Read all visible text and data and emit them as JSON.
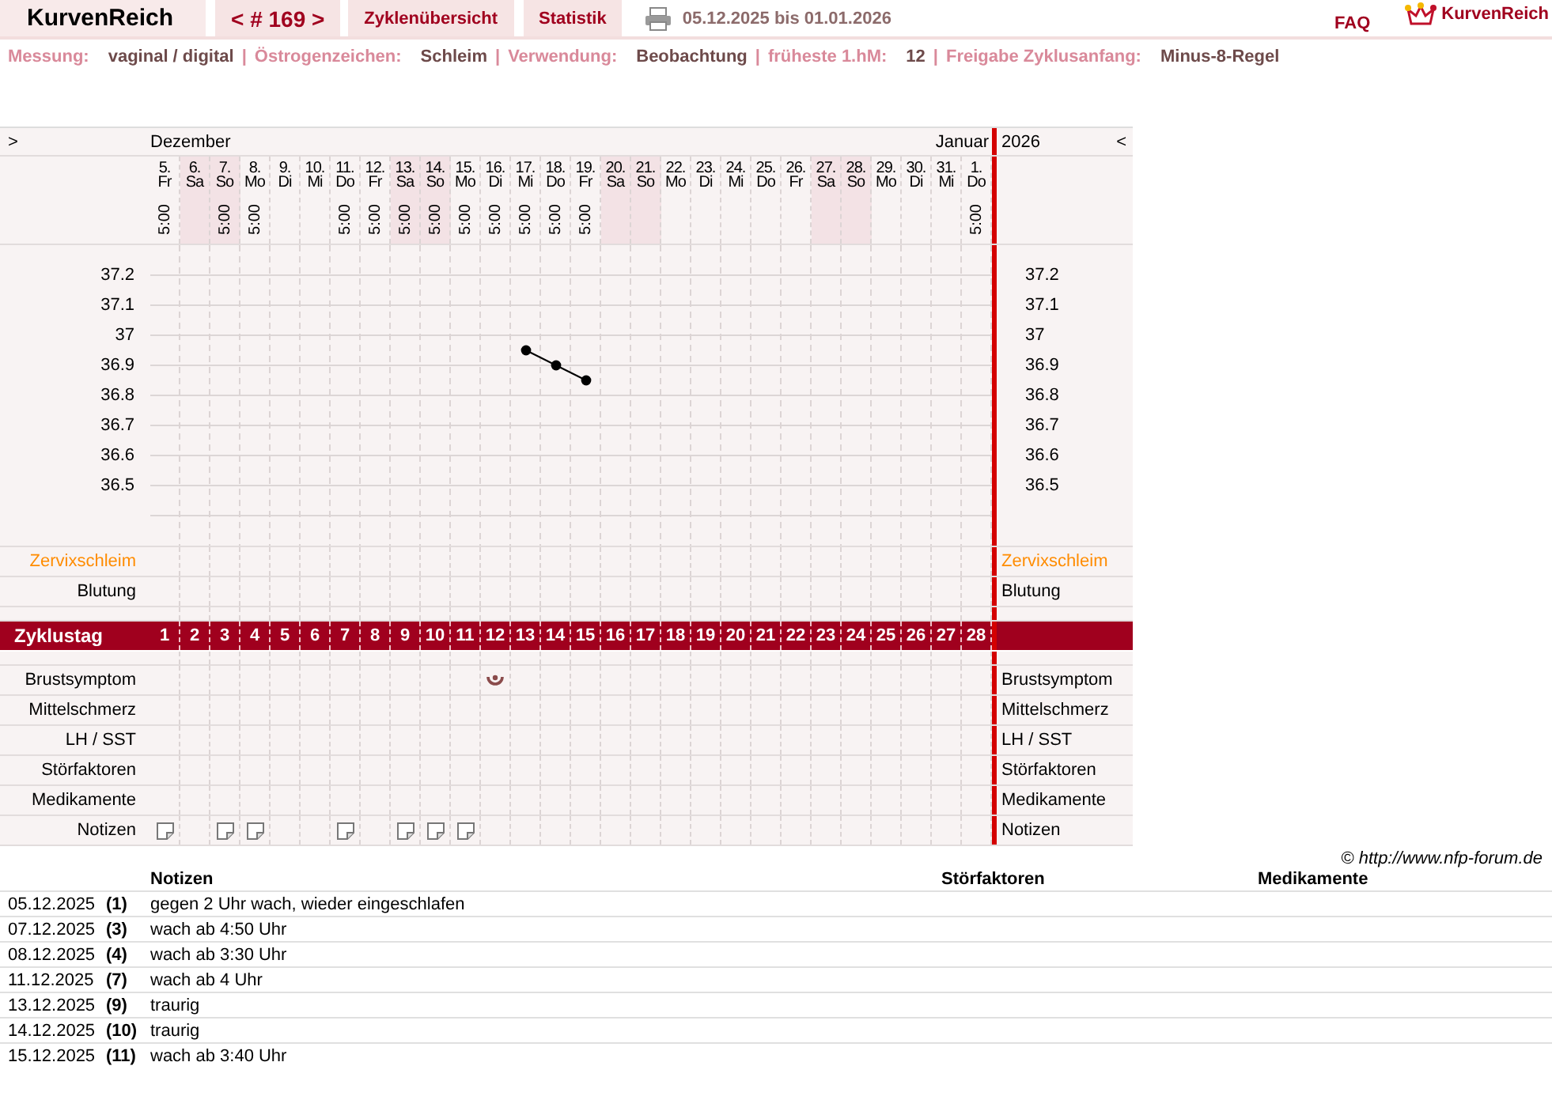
{
  "header": {
    "brand": "KurvenReich",
    "tabs": [
      {
        "label": "< # 169 >"
      },
      {
        "label": "Zyklenübersicht"
      },
      {
        "label": "Statistik"
      }
    ],
    "date_range": "05.12.2025 bis 01.01.2026",
    "faq": "FAQ",
    "logo_text": "KurvenReich"
  },
  "settings": {
    "separator": "|",
    "items": [
      {
        "label": "Messung:",
        "value": "vaginal / digital"
      },
      {
        "label": "Östrogenzeichen:",
        "value": "Schleim"
      },
      {
        "label": "Verwendung:",
        "value": "Beobachtung"
      },
      {
        "label": "früheste 1.hM:",
        "value": "12"
      },
      {
        "label": "Freigabe Zyklusanfang:",
        "value": "Minus-8-Regel"
      }
    ]
  },
  "cycle_chart": {
    "collapse_left": ">",
    "collapse_right": "<",
    "month_start": "Dezember",
    "month_end": "Januar",
    "year": "2026",
    "days": [
      {
        "date": "5.",
        "weekday": "Fr",
        "time": "5:00",
        "weekend": false,
        "cycle_day": "1",
        "symptom": false,
        "note": true
      },
      {
        "date": "6.",
        "weekday": "Sa",
        "weekend": true,
        "cycle_day": "2",
        "symptom": false,
        "note": false
      },
      {
        "date": "7.",
        "weekday": "So",
        "time": "5:00",
        "weekend": true,
        "cycle_day": "3",
        "symptom": false,
        "note": true
      },
      {
        "date": "8.",
        "weekday": "Mo",
        "time": "5:00",
        "weekend": false,
        "cycle_day": "4",
        "symptom": false,
        "note": true
      },
      {
        "date": "9.",
        "weekday": "Di",
        "weekend": false,
        "cycle_day": "5",
        "symptom": false,
        "note": false
      },
      {
        "date": "10.",
        "weekday": "Mi",
        "weekend": false,
        "cycle_day": "6",
        "symptom": false,
        "note": false
      },
      {
        "date": "11.",
        "weekday": "Do",
        "time": "5:00",
        "weekend": false,
        "cycle_day": "7",
        "symptom": false,
        "note": true
      },
      {
        "date": "12.",
        "weekday": "Fr",
        "time": "5:00",
        "weekend": false,
        "cycle_day": "8",
        "symptom": false,
        "note": false
      },
      {
        "date": "13.",
        "weekday": "Sa",
        "time": "5:00",
        "weekend": true,
        "cycle_day": "9",
        "symptom": false,
        "note": true
      },
      {
        "date": "14.",
        "weekday": "So",
        "time": "5:00",
        "weekend": true,
        "cycle_day": "10",
        "symptom": false,
        "note": true
      },
      {
        "date": "15.",
        "weekday": "Mo",
        "time": "5:00",
        "weekend": false,
        "cycle_day": "11",
        "symptom": false,
        "note": true
      },
      {
        "date": "16.",
        "weekday": "Di",
        "time": "5:00",
        "weekend": false,
        "cycle_day": "12",
        "symptom": true,
        "note": false
      },
      {
        "date": "17.",
        "weekday": "Mi",
        "time": "5:00",
        "weekend": false,
        "cycle_day": "13",
        "symptom": false,
        "note": false
      },
      {
        "date": "18.",
        "weekday": "Do",
        "time": "5:00",
        "weekend": false,
        "cycle_day": "14",
        "symptom": false,
        "note": false
      },
      {
        "date": "19.",
        "weekday": "Fr",
        "time": "5:00",
        "weekend": false,
        "cycle_day": "15",
        "symptom": false,
        "note": false
      },
      {
        "date": "20.",
        "weekday": "Sa",
        "weekend": true,
        "cycle_day": "16",
        "symptom": false,
        "note": false
      },
      {
        "date": "21.",
        "weekday": "So",
        "weekend": true,
        "cycle_day": "17",
        "symptom": false,
        "note": false
      },
      {
        "date": "22.",
        "weekday": "Mo",
        "weekend": false,
        "cycle_day": "18",
        "symptom": false,
        "note": false
      },
      {
        "date": "23.",
        "weekday": "Di",
        "weekend": false,
        "cycle_day": "19",
        "symptom": false,
        "note": false
      },
      {
        "date": "24.",
        "weekday": "Mi",
        "weekend": false,
        "cycle_day": "20",
        "symptom": false,
        "note": false
      },
      {
        "date": "25.",
        "weekday": "Do",
        "weekend": false,
        "cycle_day": "21",
        "symptom": false,
        "note": false
      },
      {
        "date": "26.",
        "weekday": "Fr",
        "weekend": false,
        "cycle_day": "22",
        "symptom": false,
        "note": false
      },
      {
        "date": "27.",
        "weekday": "Sa",
        "weekend": true,
        "cycle_day": "23",
        "symptom": false,
        "note": false
      },
      {
        "date": "28.",
        "weekday": "So",
        "weekend": true,
        "cycle_day": "24",
        "symptom": false,
        "note": false
      },
      {
        "date": "29.",
        "weekday": "Mo",
        "weekend": false,
        "cycle_day": "25",
        "symptom": false,
        "note": false
      },
      {
        "date": "30.",
        "weekday": "Di",
        "weekend": false,
        "cycle_day": "26",
        "symptom": false,
        "note": false
      },
      {
        "date": "31.",
        "weekday": "Mi",
        "weekend": false,
        "cycle_day": "27",
        "symptom": false,
        "note": false
      },
      {
        "date": "1.",
        "weekday": "Do",
        "time": "5:00",
        "weekend": false,
        "cycle_day": "28",
        "symptom": false,
        "note": false
      }
    ],
    "temperature": {
      "right_axis_labels": [
        "37.2",
        "37.1",
        "37",
        "36.9",
        "36.8",
        "36.7",
        "36.6",
        "36.5"
      ],
      "chart_data": {
        "type": "line",
        "grid": true,
        "series": [
          {
            "color": "#000000",
            "marker": true,
            "values": [
              null,
              null,
              null,
              null,
              null,
              null,
              null,
              null,
              null,
              null,
              null,
              null,
              36.95,
              36.9,
              36.85,
              null,
              null,
              null,
              null,
              null,
              null,
              null,
              null,
              null,
              null,
              null,
              null,
              null
            ]
          }
        ],
        "ylim": [
          36.3,
          37.3
        ],
        "yticks": [
          37.2,
          37.1,
          37.0,
          36.9,
          36.8,
          36.7,
          36.6,
          36.5
        ]
      }
    },
    "upper_rows": [
      {
        "left_label": "Zervixschleim",
        "right_label": "Zervixschleim",
        "color": "#ff8c00"
      },
      {
        "left_label": "Blutung",
        "right_label": "Blutung",
        "color": "#000000"
      }
    ],
    "cycle_day_label": "Zyklustag",
    "lower_rows": [
      {
        "kind": "symptom",
        "left_label": "Brustsymptom",
        "right_label": "Brustsymptom"
      },
      {
        "kind": "plain",
        "left_label": "Mittelschmerz",
        "right_label": "Mittelschmerz"
      },
      {
        "kind": "plain",
        "left_label": "LH / SST",
        "right_label": "LH / SST"
      },
      {
        "kind": "plain",
        "left_label": "Störfaktoren",
        "right_label": "Störfaktoren"
      },
      {
        "kind": "plain",
        "left_label": "Medikamente",
        "right_label": "Medikamente"
      },
      {
        "kind": "note",
        "left_label": "Notizen",
        "right_label": "Notizen"
      }
    ]
  },
  "copyright": "© http://www.nfp-forum.de",
  "notes_table": {
    "columns": [
      "Notizen",
      "Störfaktoren",
      "Medikamente"
    ],
    "rows": [
      {
        "date": "05.12.2025",
        "cycle_day": "(1)",
        "note": "gegen 2 Uhr wach, wieder eingeschlafen"
      },
      {
        "date": "07.12.2025",
        "cycle_day": "(3)",
        "note": "wach ab 4:50 Uhr"
      },
      {
        "date": "08.12.2025",
        "cycle_day": "(4)",
        "note": "wach ab 3:30 Uhr"
      },
      {
        "date": "11.12.2025",
        "cycle_day": "(7)",
        "note": "wach ab 4 Uhr"
      },
      {
        "date": "13.12.2025",
        "cycle_day": "(9)",
        "note": "traurig"
      },
      {
        "date": "14.12.2025",
        "cycle_day": "(10)",
        "note": "traurig"
      },
      {
        "date": "15.12.2025",
        "cycle_day": "(11)",
        "note": "wach ab 3:40 Uhr"
      }
    ]
  }
}
